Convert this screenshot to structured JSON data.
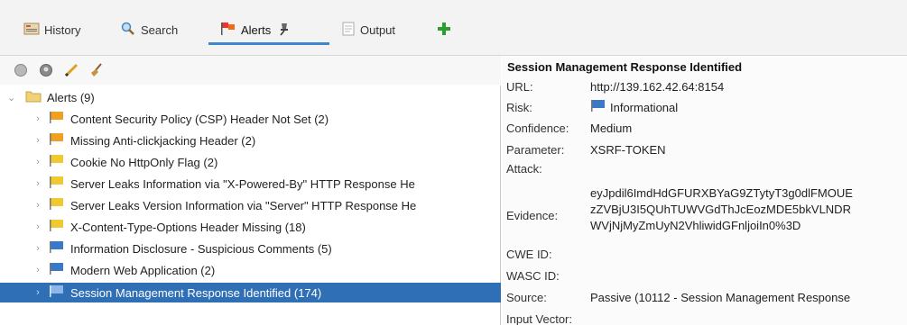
{
  "tabs": [
    {
      "label": "History",
      "icon": "history-icon"
    },
    {
      "label": "Search",
      "icon": "search-icon"
    },
    {
      "label": "Alerts",
      "icon": "alerts-flag-icon",
      "pin_icon": "pin-icon",
      "active": true
    },
    {
      "label": "Output",
      "icon": "output-icon"
    }
  ],
  "add_tab_icon": "plus-icon",
  "toolbar": {
    "icons": [
      "grey-circle-icon",
      "grey-circle-dark-icon",
      "edit-pencil-icon",
      "broom-icon"
    ]
  },
  "alerts_tree": {
    "root_label": "Alerts (9)",
    "items": [
      {
        "label": "Content Security Policy (CSP) Header Not Set (2)",
        "risk": "medium",
        "flag_color": "#f0a020"
      },
      {
        "label": "Missing Anti-clickjacking Header (2)",
        "risk": "medium",
        "flag_color": "#f0a020"
      },
      {
        "label": "Cookie No HttpOnly Flag (2)",
        "risk": "low",
        "flag_color": "#f0c830"
      },
      {
        "label": "Server Leaks Information via \"X-Powered-By\" HTTP Response He",
        "risk": "low",
        "flag_color": "#f0c830"
      },
      {
        "label": "Server Leaks Version Information via \"Server\" HTTP Response He",
        "risk": "low",
        "flag_color": "#f0c830"
      },
      {
        "label": "X-Content-Type-Options Header Missing (18)",
        "risk": "low",
        "flag_color": "#f0c830"
      },
      {
        "label": "Information Disclosure - Suspicious Comments (5)",
        "risk": "informational",
        "flag_color": "#3a78c8"
      },
      {
        "label": "Modern Web Application (2)",
        "risk": "informational",
        "flag_color": "#3a78c8"
      },
      {
        "label": "Session Management Response Identified (174)",
        "risk": "informational",
        "flag_color": "#3a78c8",
        "selected": true
      }
    ]
  },
  "details": {
    "title": "Session Management Response Identified",
    "url_label": "URL:",
    "url_value": "http://139.162.42.64:8154",
    "risk_label": "Risk:",
    "risk_value": "Informational",
    "confidence_label": "Confidence:",
    "confidence_value": "Medium",
    "parameter_label": "Parameter:",
    "parameter_value": "XSRF-TOKEN",
    "attack_label": "Attack:",
    "evidence_label": "Evidence:",
    "evidence_lines": [
      "eyJpdil6ImdHdGFURXBYaG9ZTytyT3g0dlFMOUE",
      "zZVBjU3I5QUhTUWVGdThJcEozMDE5bkVLNDR",
      "WVjNjMyZmUyN2VhliwidGFnljoiIn0%3D"
    ],
    "cwe_label": "CWE ID:",
    "wasc_label": "WASC ID:",
    "source_label": "Source:",
    "source_value": "Passive (10112 - Session Management Response",
    "input_vector_label": "Input Vector:"
  },
  "colors": {
    "selected_row": "#2f6fb6",
    "informational_flag": "#3a78c8",
    "medium_flag": "#f0a020",
    "low_flag": "#f0c830",
    "tab_underline": "#3e86d0"
  }
}
